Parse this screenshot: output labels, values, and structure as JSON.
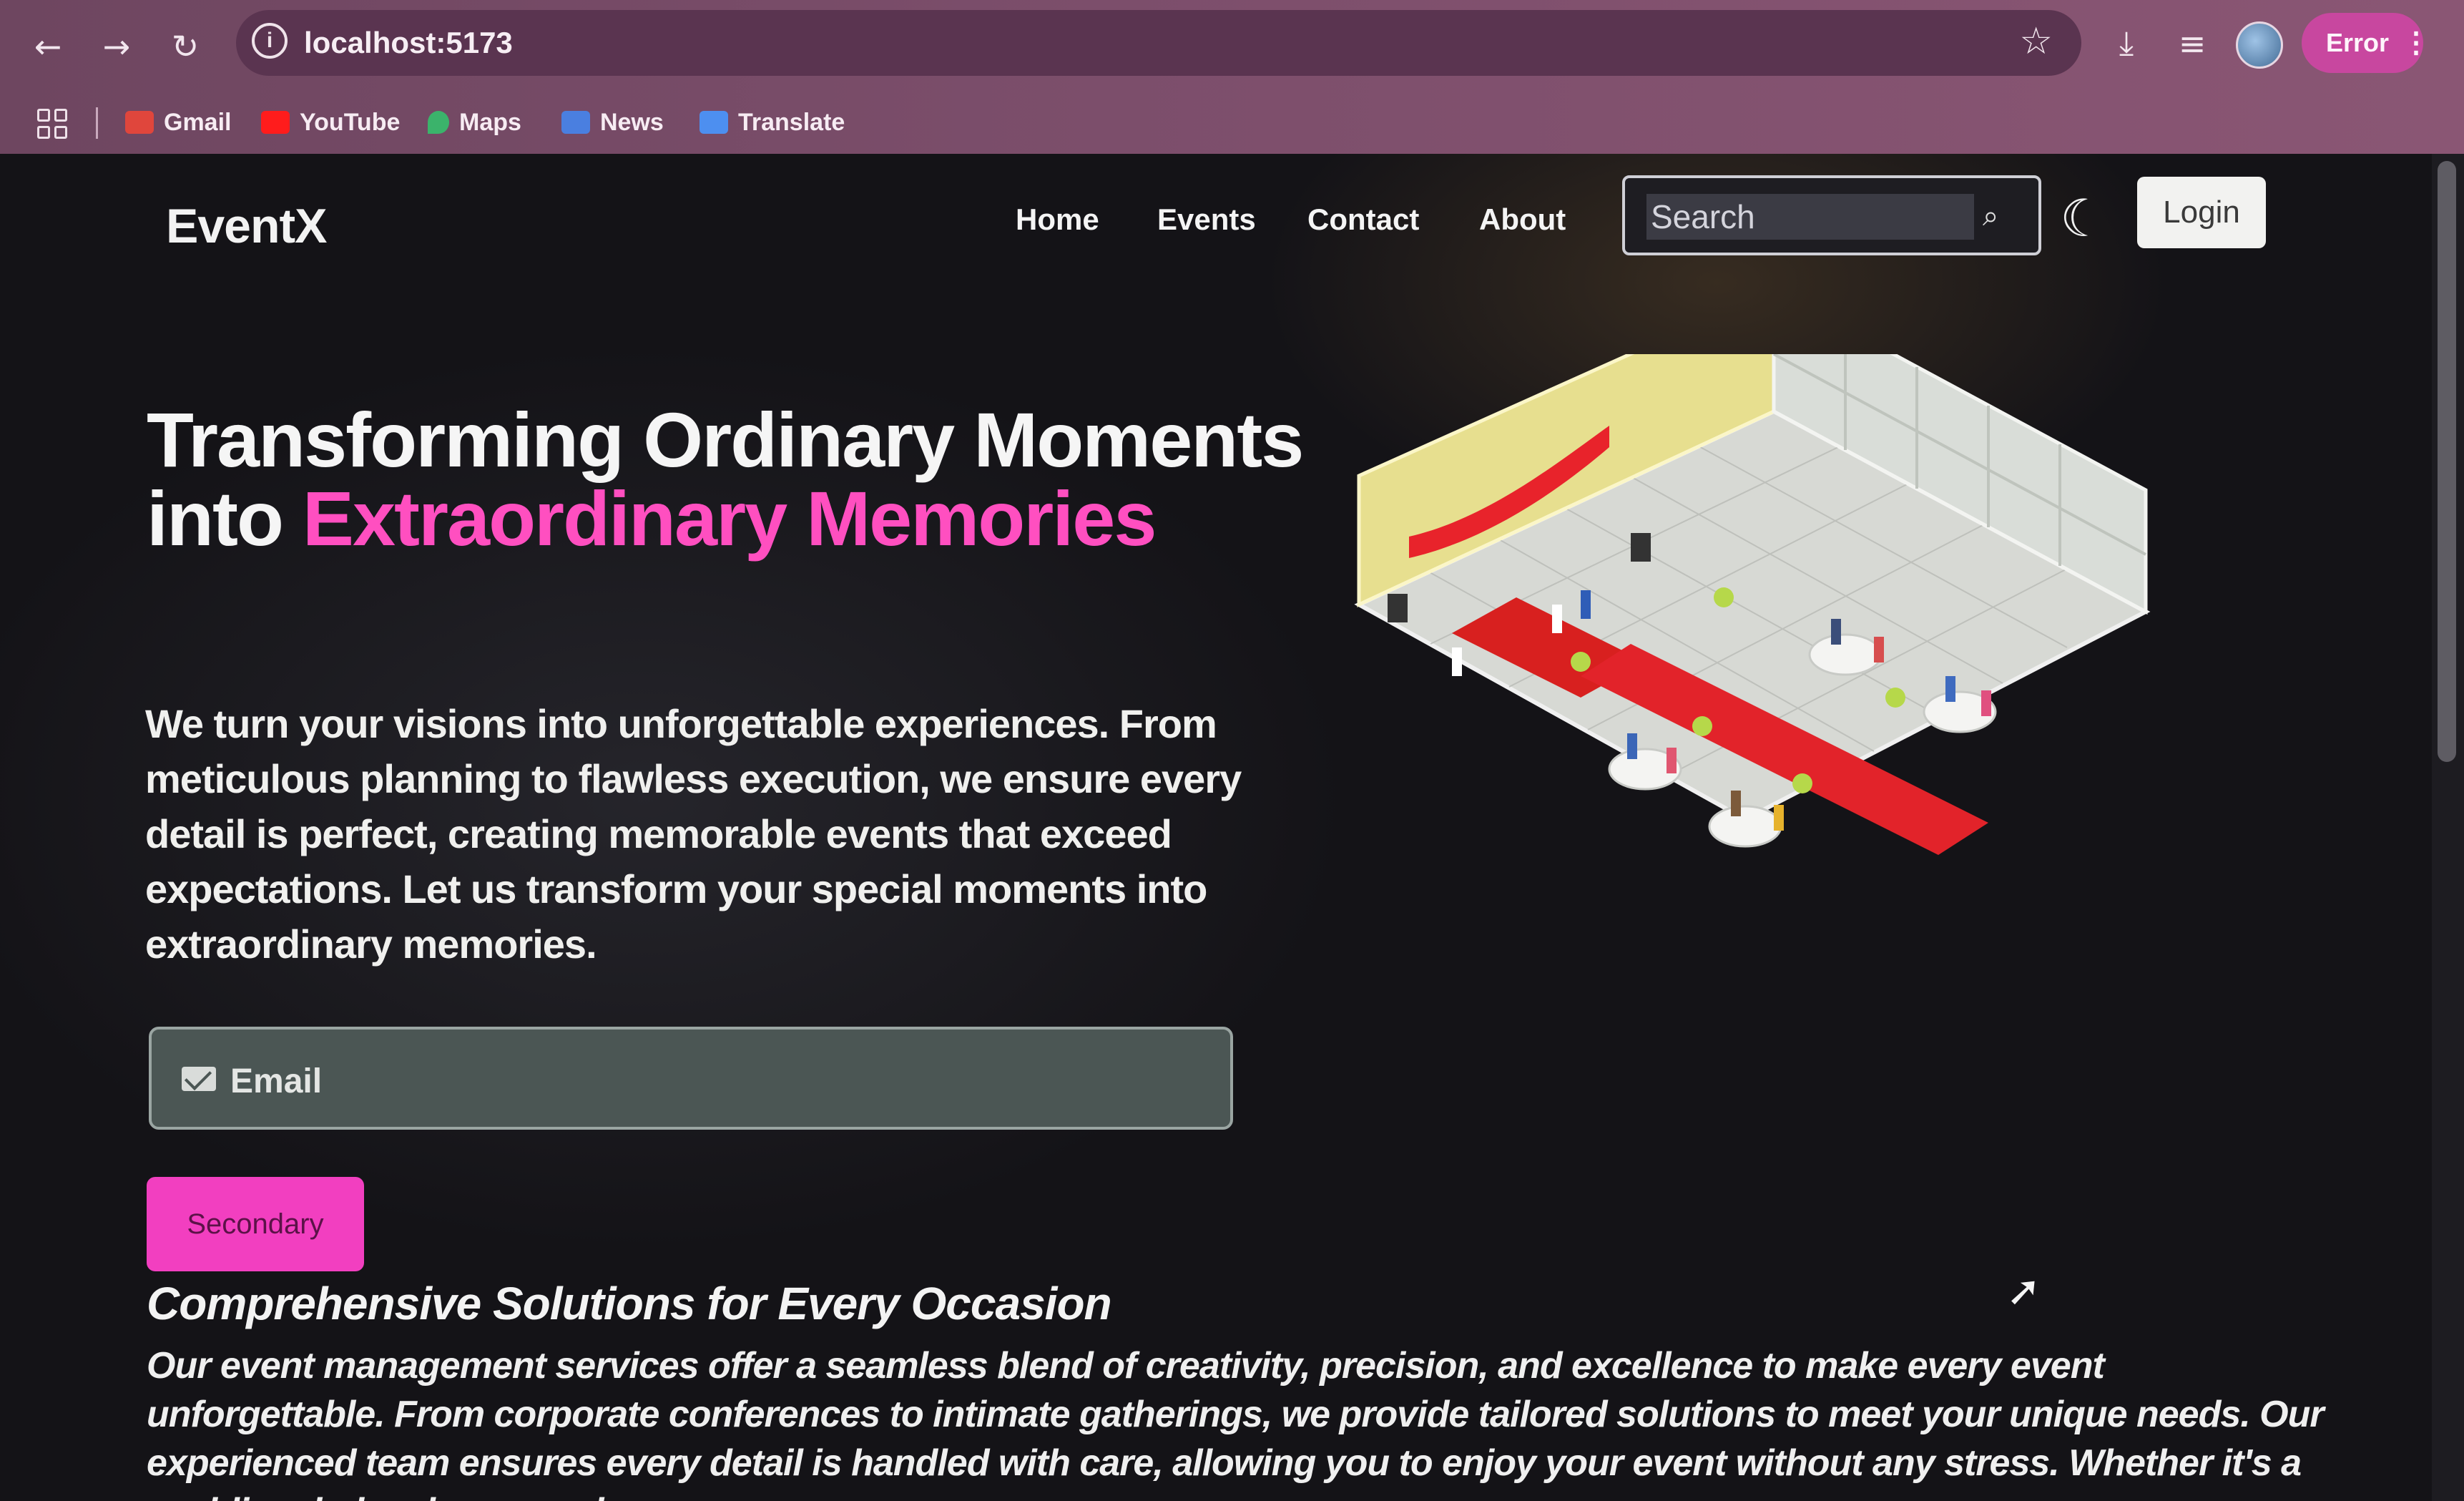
{
  "browser": {
    "url": "localhost:5173",
    "error_label": "Error",
    "bookmarks": [
      {
        "label": "Gmail",
        "icon": "gmail-icon",
        "color": "#e0463c"
      },
      {
        "label": "YouTube",
        "icon": "youtube-icon",
        "color": "#ff1c1c"
      },
      {
        "label": "Maps",
        "icon": "maps-icon",
        "color": "#3bb36b"
      },
      {
        "label": "News",
        "icon": "news-icon",
        "color": "#4a7fe0"
      },
      {
        "label": "Translate",
        "icon": "translate-icon",
        "color": "#4d8ff0"
      }
    ]
  },
  "navbar": {
    "logo": "EventX",
    "links": [
      "Home",
      "Events",
      "Contact",
      "About"
    ],
    "search_placeholder": "Search",
    "login_label": "Login"
  },
  "hero": {
    "title_part1": "Transforming Ordinary Moments into ",
    "title_accent": "Extraordinary Memories",
    "description": "We turn your visions into unforgettable experiences. From meticulous planning to flawless execution, we ensure every detail is perfect, creating memorable events that exceed expectations. Let us transform your special moments into extraordinary memories.",
    "email_placeholder": "Email",
    "button_label": "Secondary",
    "illustration": "event-hall-illustration"
  },
  "section": {
    "title": "Comprehensive Solutions for Every Occasion",
    "text": "Our event management services offer a seamless blend of creativity, precision, and excellence to make every event unforgettable. From corporate conferences to intimate gatherings, we provide tailored solutions to meet your unique needs. Our experienced team ensures every detail is handled with care, allowing you to enjoy your event without any stress. Whether it's a wedding, baby shower, or house"
  },
  "colors": {
    "accent": "#ff4fc0",
    "button": "#f23fc0",
    "background": "#141317"
  }
}
